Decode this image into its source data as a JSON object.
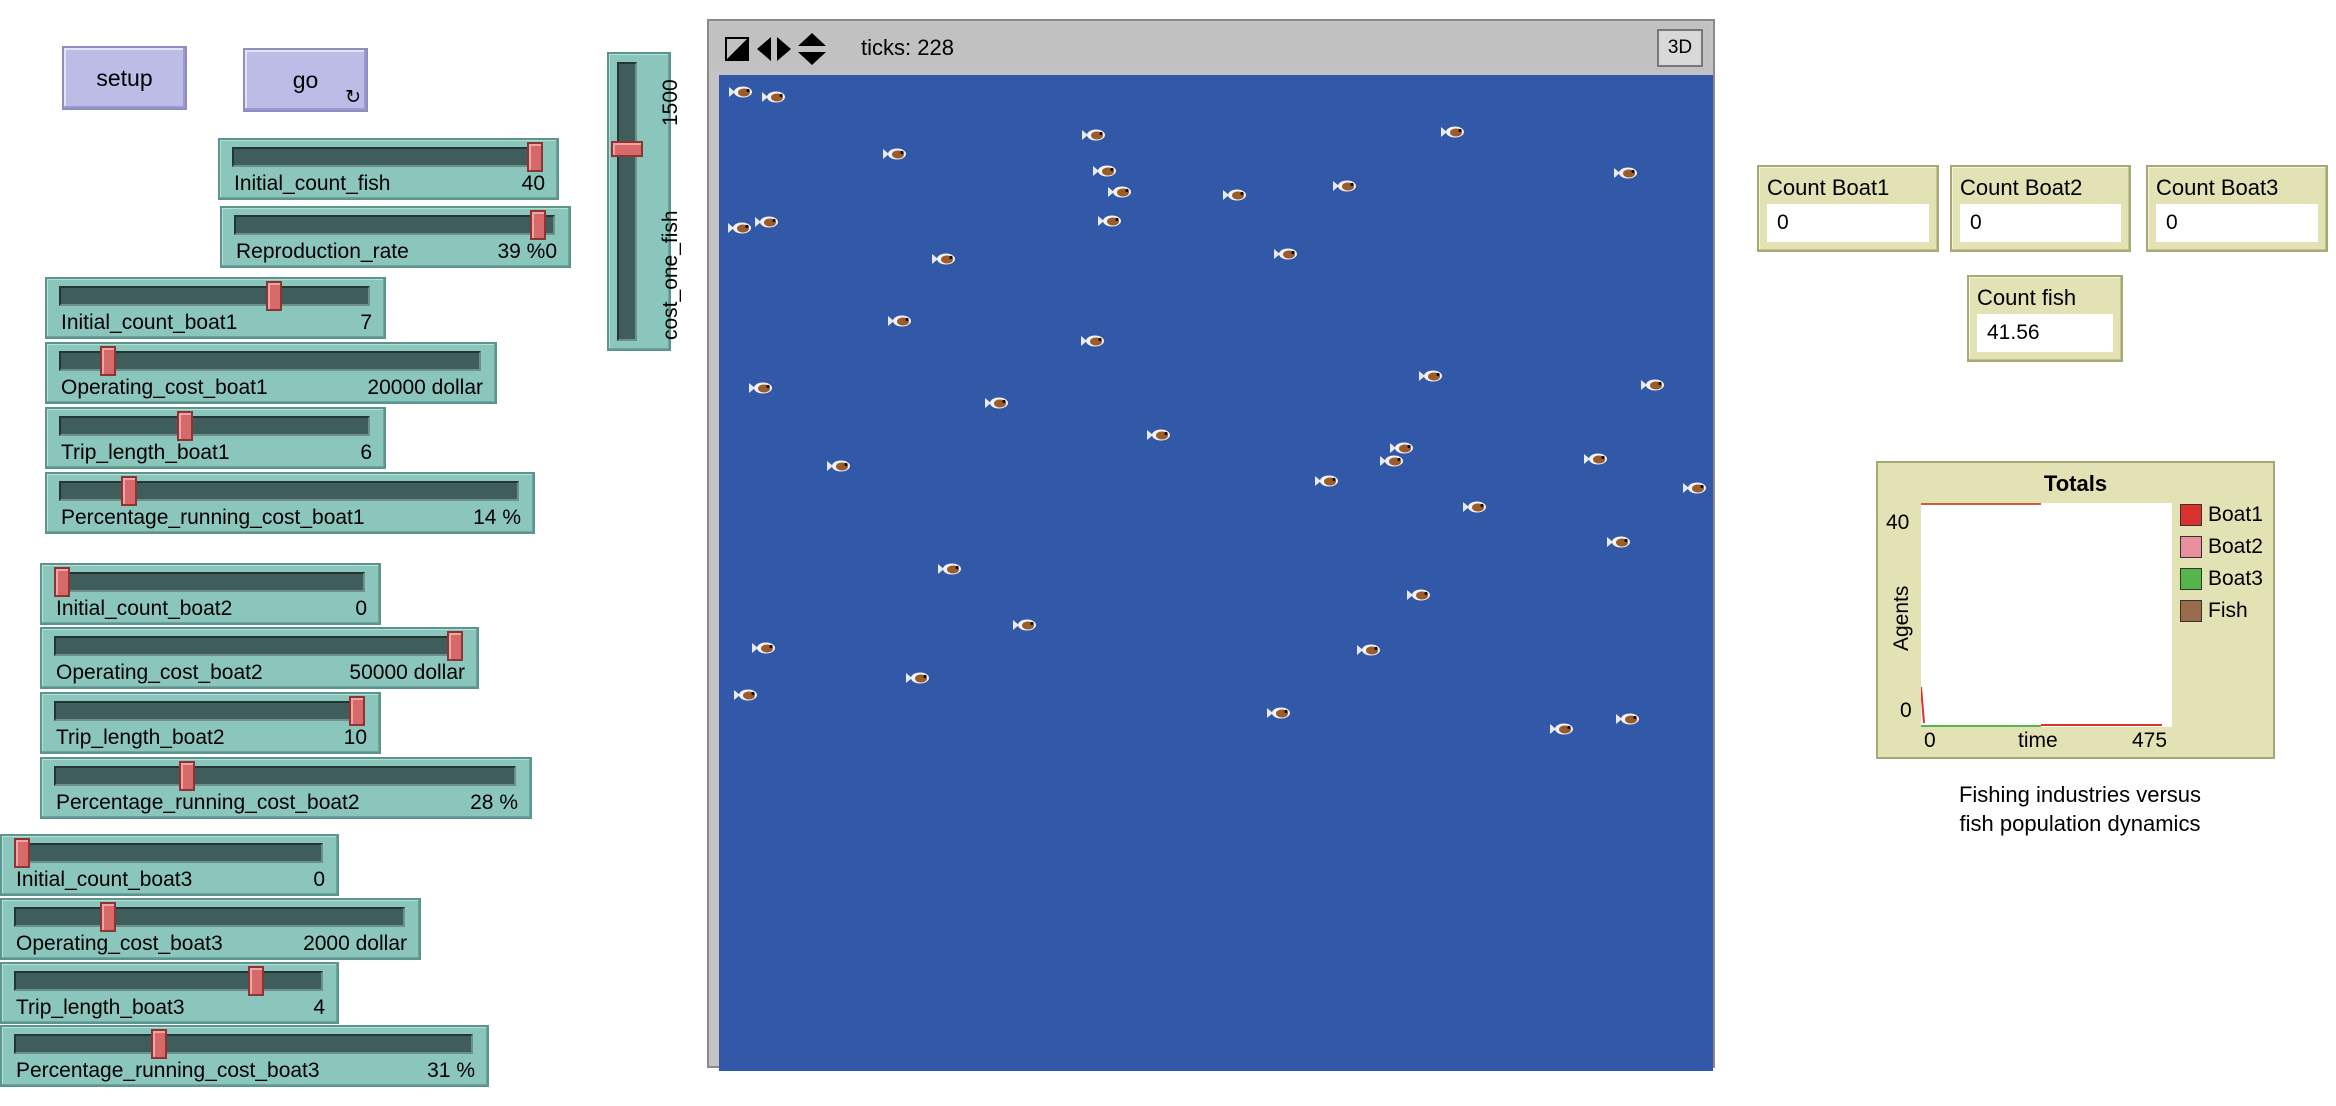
{
  "buttons": {
    "setup": "setup",
    "go": "go"
  },
  "sliders": [
    {
      "key": "initial_count_fish",
      "label": "Initial_count_fish",
      "value": "40",
      "fraction": 1.0
    },
    {
      "key": "reproduction_rate",
      "label": "Reproduction_rate",
      "value": "39 %0",
      "fraction": 0.97
    },
    {
      "key": "initial_count_boat1",
      "label": "Initial_count_boat1",
      "value": "7",
      "fraction": 0.7
    },
    {
      "key": "operating_cost_boat1",
      "label": "Operating_cost_boat1",
      "value": "20000 dollar",
      "fraction": 0.1
    },
    {
      "key": "trip_length_boat1",
      "label": "Trip_length_boat1",
      "value": "6",
      "fraction": 0.4
    },
    {
      "key": "percentage_running_cost_boat1",
      "label": "Percentage_running_cost_boat1",
      "value": "14 %",
      "fraction": 0.14
    },
    {
      "key": "initial_count_boat2",
      "label": "Initial_count_boat2",
      "value": "0",
      "fraction": 0.0
    },
    {
      "key": "operating_cost_boat2",
      "label": "Operating_cost_boat2",
      "value": "50000 dollar",
      "fraction": 1.0
    },
    {
      "key": "trip_length_boat2",
      "label": "Trip_length_boat2",
      "value": "10",
      "fraction": 1.0
    },
    {
      "key": "percentage_running_cost_boat2",
      "label": "Percentage_running_cost_boat2",
      "value": "28 %",
      "fraction": 0.28
    },
    {
      "key": "initial_count_boat3",
      "label": "Initial_count_boat3",
      "value": "0",
      "fraction": 0.0
    },
    {
      "key": "operating_cost_boat3",
      "label": "Operating_cost_boat3",
      "value": "2000 dollar",
      "fraction": 0.23
    },
    {
      "key": "trip_length_boat3",
      "label": "Trip_length_boat3",
      "value": "4",
      "fraction": 0.8
    },
    {
      "key": "percentage_running_cost_boat3",
      "label": "Percentage_running_cost_boat3",
      "value": "31 %",
      "fraction": 0.31
    }
  ],
  "vertical_slider": {
    "label": "cost_one_fish",
    "value": "1500",
    "fraction": 0.7
  },
  "view": {
    "ticks_label": "ticks: 228",
    "btn_3d": "3D"
  },
  "monitors": [
    {
      "key": "boat1",
      "label": "Count Boat1",
      "value": "0"
    },
    {
      "key": "boat2",
      "label": "Count Boat2",
      "value": "0"
    },
    {
      "key": "boat3",
      "label": "Count Boat3",
      "value": "0"
    },
    {
      "key": "fish",
      "label": "Count fish",
      "value": "41.56"
    }
  ],
  "plot": {
    "title": "Totals",
    "y_label": "Agents",
    "x_label": "time",
    "y_max": "40",
    "y_min": "0",
    "x_min": "0",
    "x_max": "475",
    "legend": [
      {
        "name": "Boat1",
        "color": "#d8312e"
      },
      {
        "name": "Boat2",
        "color": "#e88e9d"
      },
      {
        "name": "Boat3",
        "color": "#55b54a"
      },
      {
        "name": "Fish",
        "color": "#9a6a4a"
      }
    ]
  },
  "note_line1": "Fishing industries versus",
  "note_line2": "fish population dynamics",
  "fish_positions": [
    [
      0.01,
      0.01
    ],
    [
      0.043,
      0.015
    ],
    [
      0.165,
      0.072
    ],
    [
      0.365,
      0.053
    ],
    [
      0.726,
      0.05
    ],
    [
      0.9,
      0.091
    ],
    [
      0.376,
      0.089
    ],
    [
      0.391,
      0.11
    ],
    [
      0.507,
      0.113
    ],
    [
      0.618,
      0.104
    ],
    [
      0.009,
      0.147
    ],
    [
      0.036,
      0.141
    ],
    [
      0.381,
      0.14
    ],
    [
      0.214,
      0.178
    ],
    [
      0.558,
      0.173
    ],
    [
      0.17,
      0.24
    ],
    [
      0.364,
      0.26
    ],
    [
      0.704,
      0.295
    ],
    [
      0.03,
      0.307
    ],
    [
      0.268,
      0.322
    ],
    [
      0.928,
      0.304
    ],
    [
      0.431,
      0.354
    ],
    [
      0.675,
      0.367
    ],
    [
      0.665,
      0.381
    ],
    [
      0.6,
      0.401
    ],
    [
      0.87,
      0.379
    ],
    [
      0.97,
      0.408
    ],
    [
      0.109,
      0.386
    ],
    [
      0.748,
      0.427
    ],
    [
      0.893,
      0.462
    ],
    [
      0.22,
      0.489
    ],
    [
      0.692,
      0.515
    ],
    [
      0.296,
      0.545
    ],
    [
      0.033,
      0.568
    ],
    [
      0.642,
      0.57
    ],
    [
      0.188,
      0.598
    ],
    [
      0.015,
      0.615
    ],
    [
      0.551,
      0.634
    ],
    [
      0.836,
      0.65
    ],
    [
      0.902,
      0.64
    ]
  ]
}
